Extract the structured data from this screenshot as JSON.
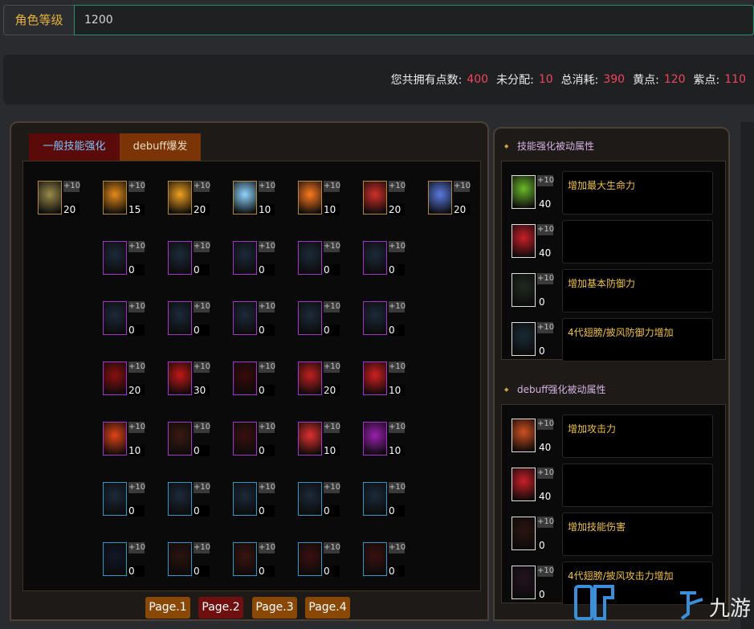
{
  "level": {
    "label": "角色等级",
    "value": "1200"
  },
  "summary": [
    {
      "label": "您共拥有点数:",
      "value": "400"
    },
    {
      "label": "未分配:",
      "value": "10"
    },
    {
      "label": "总消耗:",
      "value": "390"
    },
    {
      "label": "黄点:",
      "value": "120"
    },
    {
      "label": "紫点:",
      "value": "110"
    }
  ],
  "tabs": [
    {
      "label": "一般技能强化",
      "active": true
    },
    {
      "label": "debuff爆发",
      "active": false
    }
  ],
  "skill_rows": [
    {
      "border": "gold",
      "cells": [
        {
          "col": 0,
          "bonus": "+10",
          "value": "20",
          "color": "#9a8a4a"
        },
        {
          "col": 1,
          "bonus": "+10",
          "value": "15",
          "color": "#e38a1a"
        },
        {
          "col": 2,
          "bonus": "+10",
          "value": "20",
          "color": "#f0a020"
        },
        {
          "col": 3,
          "bonus": "+10",
          "value": "10",
          "color": "#8fd6ff"
        },
        {
          "col": 4,
          "bonus": "+10",
          "value": "10",
          "color": "#ff7a20"
        },
        {
          "col": 5,
          "bonus": "+10",
          "value": "20",
          "color": "#d0302a"
        },
        {
          "col": 6,
          "bonus": "+10",
          "value": "20",
          "color": "#5a7ae0"
        }
      ]
    },
    {
      "border": "purple",
      "cells": [
        {
          "col": 1,
          "bonus": "+10",
          "value": "0",
          "color": "#1c2a3a"
        },
        {
          "col": 2,
          "bonus": "+10",
          "value": "0",
          "color": "#1c2a3a"
        },
        {
          "col": 3,
          "bonus": "+10",
          "value": "0",
          "color": "#1c2a3a"
        },
        {
          "col": 4,
          "bonus": "+10",
          "value": "0",
          "color": "#1c2a3a"
        },
        {
          "col": 5,
          "bonus": "+10",
          "value": "0",
          "color": "#1c2a3a"
        }
      ]
    },
    {
      "border": "purple",
      "cells": [
        {
          "col": 1,
          "bonus": "+10",
          "value": "0",
          "color": "#1c2a3a"
        },
        {
          "col": 2,
          "bonus": "+10",
          "value": "0",
          "color": "#1c2a3a"
        },
        {
          "col": 3,
          "bonus": "+10",
          "value": "0",
          "color": "#1c2a3a"
        },
        {
          "col": 4,
          "bonus": "+10",
          "value": "0",
          "color": "#1c2a3a"
        },
        {
          "col": 5,
          "bonus": "+10",
          "value": "0",
          "color": "#1c2a3a"
        }
      ]
    },
    {
      "border": "purple",
      "cells": [
        {
          "col": 1,
          "bonus": "+10",
          "value": "20",
          "color": "#8a1010"
        },
        {
          "col": 2,
          "bonus": "+10",
          "value": "30",
          "color": "#c01818"
        },
        {
          "col": 3,
          "bonus": "+10",
          "value": "0",
          "color": "#3a0a0a"
        },
        {
          "col": 4,
          "bonus": "+10",
          "value": "20",
          "color": "#c02020"
        },
        {
          "col": 5,
          "bonus": "+10",
          "value": "10",
          "color": "#d02020"
        }
      ]
    },
    {
      "border": "purple",
      "cells": [
        {
          "col": 1,
          "bonus": "+10",
          "value": "10",
          "color": "#e04418"
        },
        {
          "col": 2,
          "bonus": "+10",
          "value": "0",
          "color": "#3a1a10"
        },
        {
          "col": 3,
          "bonus": "+10",
          "value": "0",
          "color": "#3a1010"
        },
        {
          "col": 4,
          "bonus": "+10",
          "value": "10",
          "color": "#e03030"
        },
        {
          "col": 5,
          "bonus": "+10",
          "value": "10",
          "color": "#9a20b0"
        }
      ]
    },
    {
      "border": "blue",
      "cells": [
        {
          "col": 1,
          "bonus": "+10",
          "value": "0",
          "color": "#1c2a3a"
        },
        {
          "col": 2,
          "bonus": "+10",
          "value": "0",
          "color": "#1c2a3a"
        },
        {
          "col": 3,
          "bonus": "+10",
          "value": "0",
          "color": "#1c2a3a"
        },
        {
          "col": 4,
          "bonus": "+10",
          "value": "0",
          "color": "#1c2a3a"
        },
        {
          "col": 5,
          "bonus": "+10",
          "value": "0",
          "color": "#1c2a3a"
        }
      ]
    },
    {
      "border": "blue",
      "cells": [
        {
          "col": 1,
          "bonus": "+10",
          "value": "0",
          "color": "#101828"
        },
        {
          "col": 2,
          "bonus": "+10",
          "value": "0",
          "color": "#2a1410"
        },
        {
          "col": 3,
          "bonus": "+10",
          "value": "0",
          "color": "#3a1410"
        },
        {
          "col": 4,
          "bonus": "+10",
          "value": "0",
          "color": "#3a1010"
        },
        {
          "col": 5,
          "bonus": "+10",
          "value": "0",
          "color": "#3a1010"
        }
      ]
    }
  ],
  "pages": [
    {
      "label": "Page.1",
      "active": false
    },
    {
      "label": "Page.2",
      "active": true
    },
    {
      "label": "Page.3",
      "active": false
    },
    {
      "label": "Page.4",
      "active": false
    }
  ],
  "side_sections": [
    {
      "title": "技能强化被动属性",
      "items": [
        {
          "bonus": "+10",
          "value": "40",
          "desc": "增加最大生命力",
          "color": "#6ab82a"
        },
        {
          "bonus": "+10",
          "value": "40",
          "desc": "",
          "color": "#c82028"
        },
        {
          "bonus": "+10",
          "value": "0",
          "desc": "增加基本防御力",
          "color": "#202a20"
        },
        {
          "bonus": "+10",
          "value": "0",
          "desc": "4代翅膀/披风防御力增加",
          "color": "#1a2a34"
        }
      ]
    },
    {
      "title": "debuff强化被动属性",
      "items": [
        {
          "bonus": "+10",
          "value": "40",
          "desc": "增加攻击力",
          "color": "#d05020"
        },
        {
          "bonus": "+10",
          "value": "40",
          "desc": "",
          "color": "#c82028"
        },
        {
          "bonus": "+10",
          "value": "0",
          "desc": "增加技能伤害",
          "color": "#2a1410"
        },
        {
          "bonus": "+10",
          "value": "0",
          "desc": "4代翅膀/披风攻击力增加",
          "color": "#241420"
        }
      ]
    }
  ],
  "watermark": {
    "text": "九游",
    "color": "#3a8fd8"
  }
}
